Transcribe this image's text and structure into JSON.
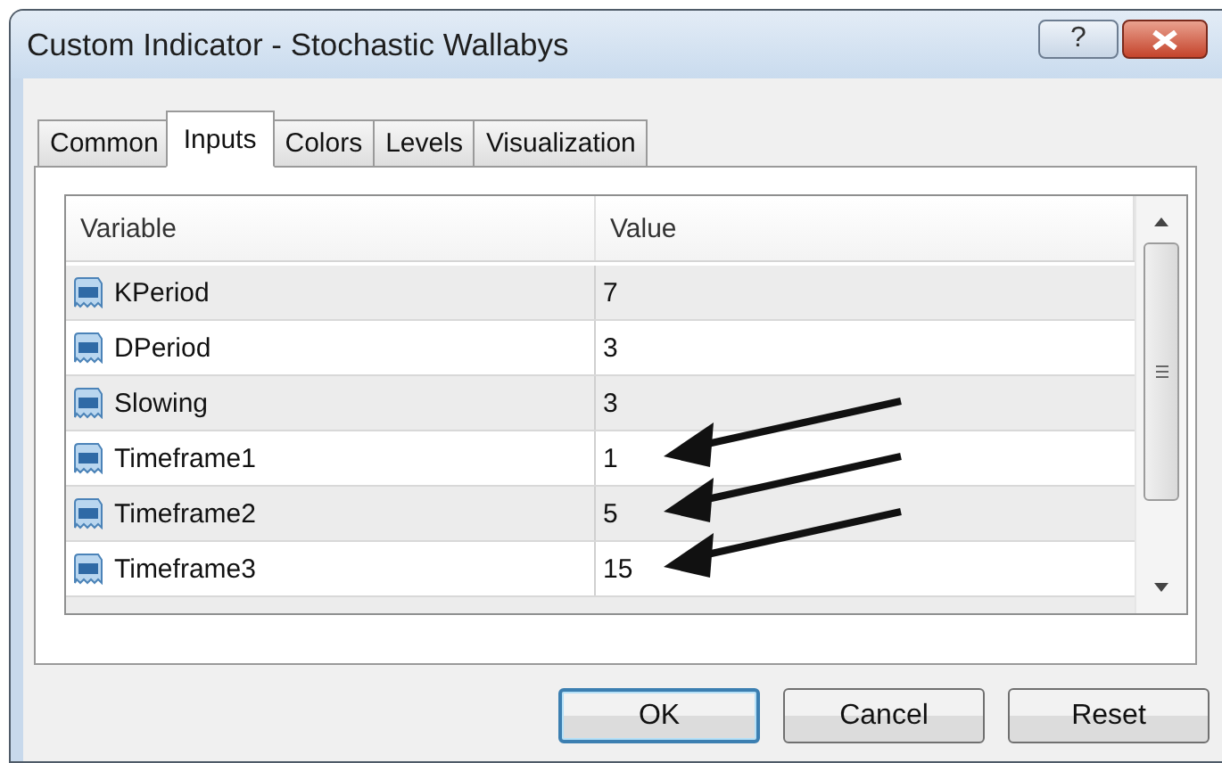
{
  "window": {
    "title": "Custom Indicator - Stochastic Wallabys",
    "help_button": "?"
  },
  "tabs": [
    {
      "label": "Common",
      "selected": false
    },
    {
      "label": "Inputs",
      "selected": true
    },
    {
      "label": "Colors",
      "selected": false
    },
    {
      "label": "Levels",
      "selected": false
    },
    {
      "label": "Visualization",
      "selected": false
    }
  ],
  "table": {
    "columns": [
      "Variable",
      "Value"
    ],
    "rows": [
      {
        "variable": "KPeriod",
        "value": "7",
        "arrow": false
      },
      {
        "variable": "DPeriod",
        "value": "3",
        "arrow": false
      },
      {
        "variable": "Slowing",
        "value": "3",
        "arrow": false
      },
      {
        "variable": "Timeframe1",
        "value": "1",
        "arrow": true
      },
      {
        "variable": "Timeframe2",
        "value": "5",
        "arrow": true
      },
      {
        "variable": "Timeframe3",
        "value": "15",
        "arrow": true
      }
    ]
  },
  "buttons": [
    {
      "label": "OK",
      "default": true
    },
    {
      "label": "Cancel",
      "default": false
    },
    {
      "label": "Reset",
      "default": false
    }
  ]
}
